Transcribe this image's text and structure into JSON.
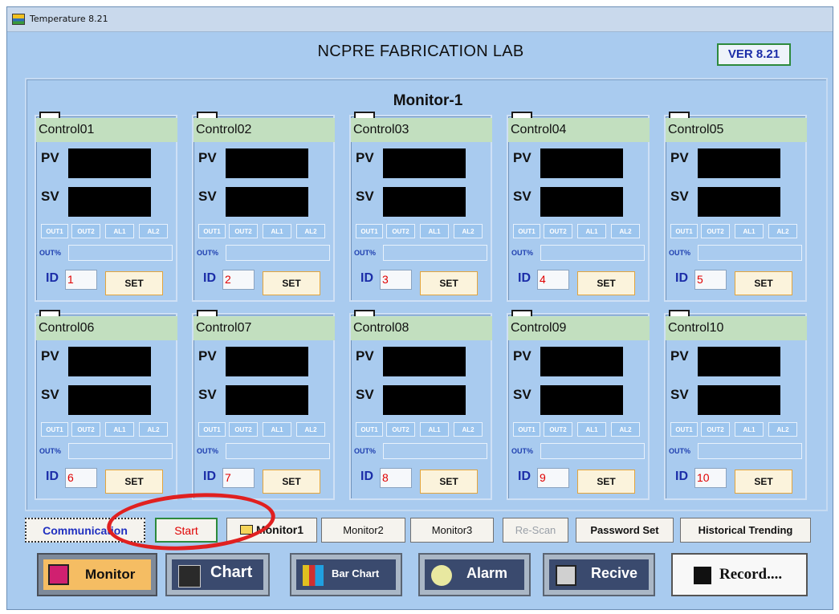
{
  "window": {
    "title": "Temperature 8.21"
  },
  "header": {
    "title": "NCPRE FABRICATION LAB",
    "version": "VER 8.21"
  },
  "monitor": {
    "title": "Monitor-1"
  },
  "panel_labels": {
    "pv": "PV",
    "sv": "SV",
    "out1": "OUT1",
    "out2": "OUT2",
    "al1": "AL1",
    "al2": "AL2",
    "out_percent": "OUT%",
    "id": "ID",
    "set": "SET"
  },
  "controls": [
    {
      "name": "Control01",
      "id": "1"
    },
    {
      "name": "Control02",
      "id": "2"
    },
    {
      "name": "Control03",
      "id": "3"
    },
    {
      "name": "Control04",
      "id": "4"
    },
    {
      "name": "Control05",
      "id": "5"
    },
    {
      "name": "Control06",
      "id": "6"
    },
    {
      "name": "Control07",
      "id": "7"
    },
    {
      "name": "Control08",
      "id": "8"
    },
    {
      "name": "Control09",
      "id": "9"
    },
    {
      "name": "Control10",
      "id": "10"
    }
  ],
  "toolbar": {
    "communication": "Communication",
    "start": "Start",
    "monitor1": "Monitor1",
    "monitor2": "Monitor2",
    "monitor3": "Monitor3",
    "rescan": "Re-Scan",
    "password_set": "Password Set",
    "historical_trending": "Historical Trending"
  },
  "bottom_nav": {
    "monitor": "Monitor",
    "chart": "Chart",
    "bar_chart": "Bar Chart",
    "alarm": "Alarm",
    "recive": "Recive",
    "record": "Record...."
  },
  "colors": {
    "window_bg": "#a9cbef",
    "panel_header": "#c2dfbf",
    "id_text": "#e00000",
    "annotation_circle": "#e02020"
  },
  "icons": [
    "app-icon",
    "folder-icon",
    "monitor-icon",
    "chart-icon",
    "bar-chart-icon",
    "alarm-icon",
    "calculator-icon",
    "floppy-disk-icon"
  ]
}
